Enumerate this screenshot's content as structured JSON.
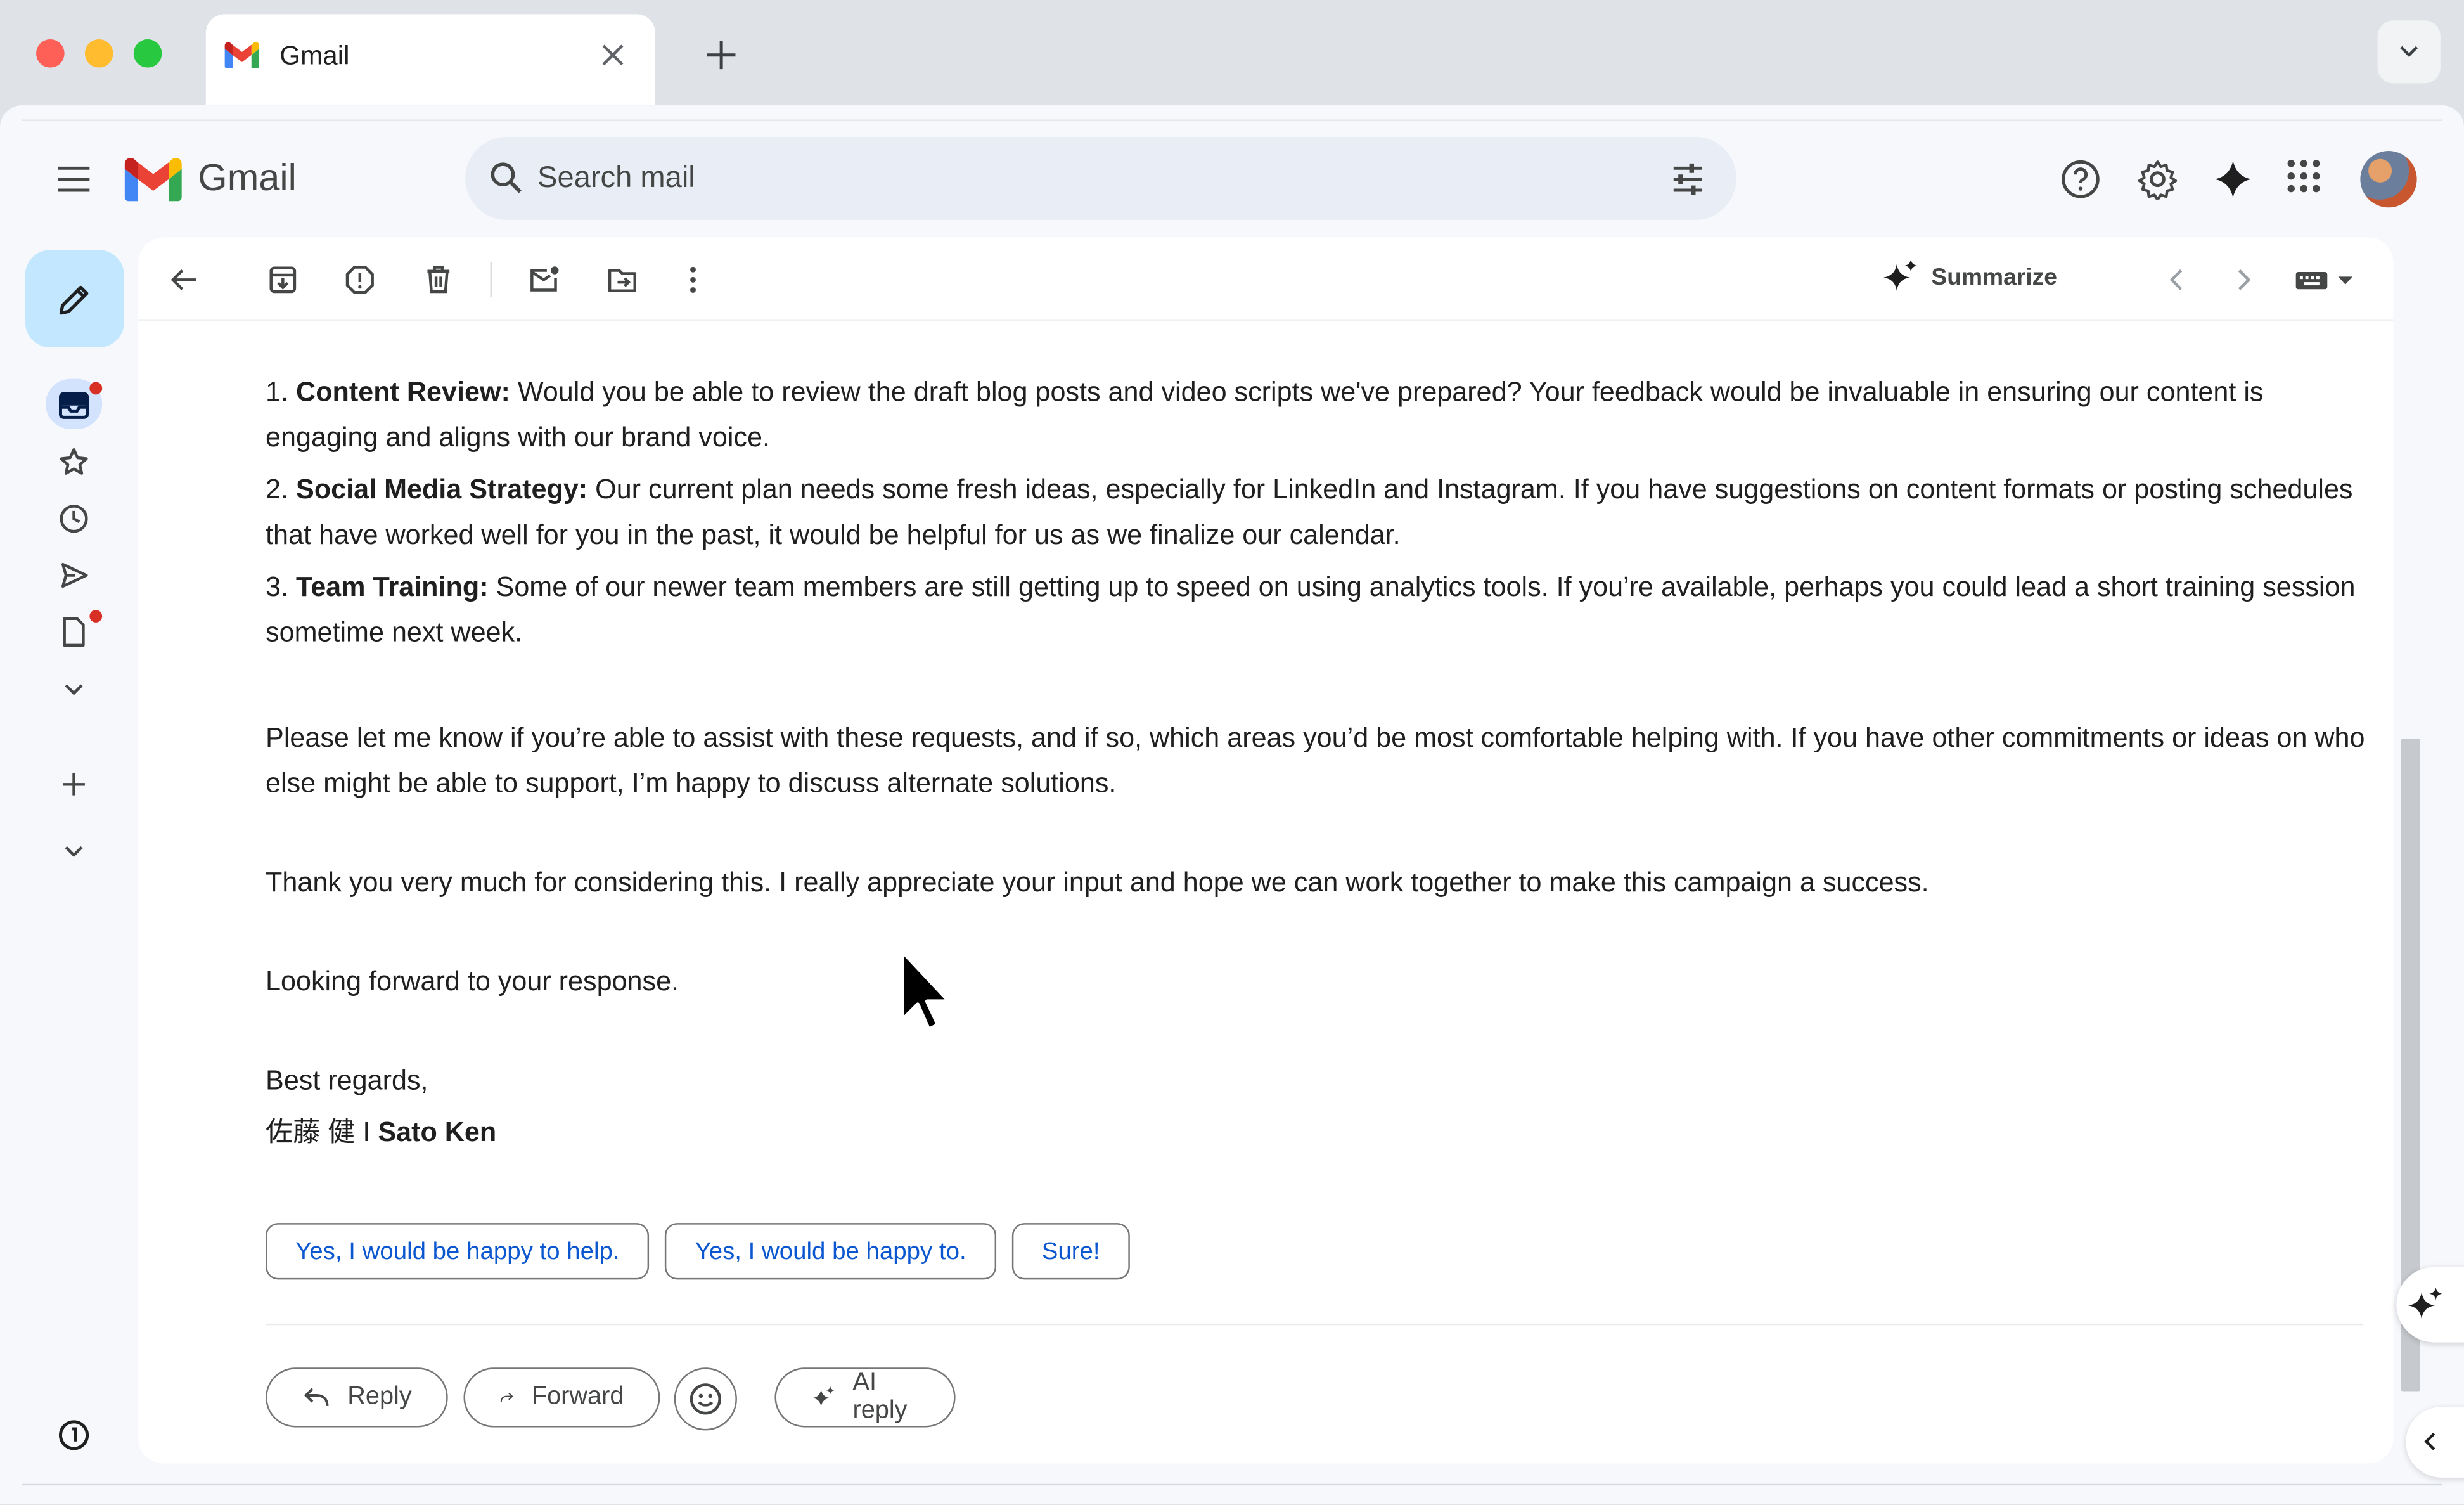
{
  "browser": {
    "tab_title": "Gmail"
  },
  "header": {
    "product_name": "Gmail",
    "search_placeholder": "Search mail"
  },
  "toolbar": {
    "summarize_label": "Summarize"
  },
  "email": {
    "items": [
      {
        "number": "1.",
        "title": "Content Review:",
        "text": " Would you be able to review the draft blog posts and video scripts we've prepared? Your feedback would be invaluable in ensuring our content is engaging and aligns with our brand voice."
      },
      {
        "number": "2.",
        "title": "Social Media Strategy:",
        "text": " Our current plan needs some fresh ideas, especially for LinkedIn and Instagram. If you have suggestions on content formats or posting schedules that have worked well for you in the past, it would be helpful for us as we finalize our calendar."
      },
      {
        "number": "3.",
        "title": "Team Training:",
        "text": " Some of our newer team members are still getting up to speed on using analytics tools. If you’re available, perhaps you could lead a short training session sometime next week."
      }
    ],
    "paragraph_1": "Please let me know if you’re able to assist with these requests, and if so, which areas you’d be most comfortable helping with. If you have other commitments or ideas on who else might be able to support, I’m happy to discuss alternate solutions.",
    "paragraph_2": "Thank you very much for considering this. I really appreciate your input and hope we can work together to make this campaign a success.",
    "paragraph_3": "Looking forward to your response.",
    "closing": "Best regards,",
    "signature_prefix": "佐藤 健 I ",
    "signature_name": "Sato Ken"
  },
  "smart_replies": [
    "Yes, I would be happy to help.",
    "Yes, I would be happy to.",
    "Sure!"
  ],
  "actions": {
    "reply": "Reply",
    "forward": "Forward",
    "ai_reply": "AI reply"
  },
  "colors": {
    "accent_blue": "#0b57d0",
    "compose_bg": "#c2e7ff",
    "notification_dot": "#d93025"
  }
}
